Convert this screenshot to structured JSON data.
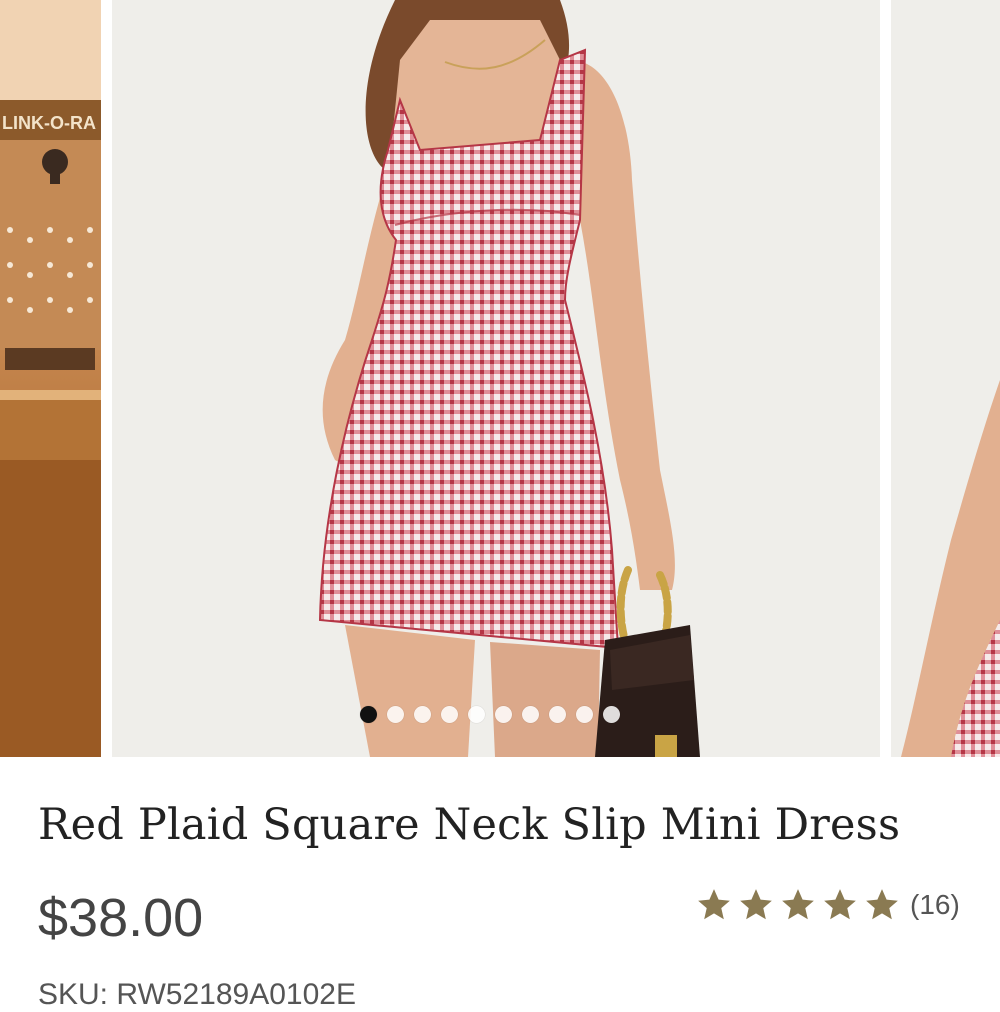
{
  "product": {
    "title": "Red Plaid Square Neck Slip Mini Dress",
    "price": "$38.00",
    "rating": {
      "stars": 5,
      "max_stars": 5,
      "count_label": "(16)",
      "star_color": "#8a7a52"
    },
    "sku_text": "SKU: RW52189A0102E"
  },
  "gallery": {
    "prev_sign_text": "LINK-O-RA",
    "dot_count": 10,
    "active_dot": 0,
    "dress_color": "#c0404e",
    "bag_color": "#2b1d19"
  }
}
